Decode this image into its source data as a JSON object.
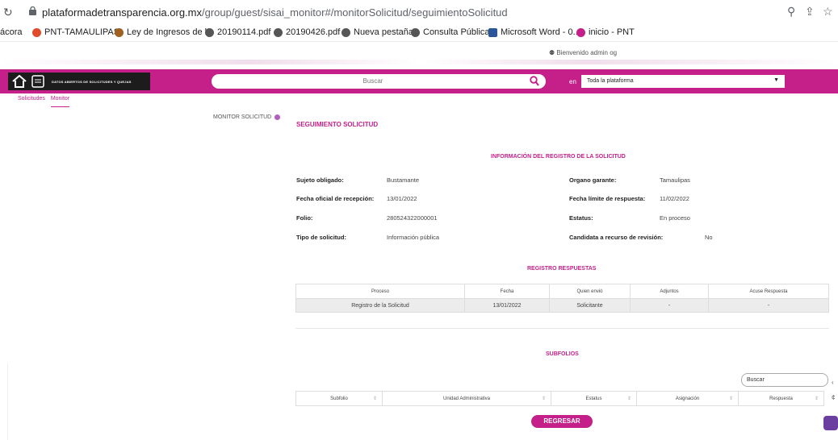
{
  "browser": {
    "url_host": "plataformadetransparencia.org.mx",
    "url_path": "/group/guest/sisai_monitor#/monitorSolicitud/seguimientoSolicitud",
    "bookmarks": [
      "ácora",
      "PNT-TAMAULIPAS",
      "Ley de Ingresos de l...",
      "20190114.pdf",
      "20190426.pdf",
      "Nueva pestaña",
      "Consulta Pública",
      "Microsoft Word - 0...",
      "inicio - PNT"
    ]
  },
  "header": {
    "welcome": "Bienvenido admin og",
    "logo_text": "DATOS ABIERTOS DE SOLICITUDES Y QUEJAS",
    "search_placeholder": "Buscar",
    "scope_prefix": "en",
    "scope_value": "Toda la plataforma"
  },
  "subnav": {
    "items": [
      "Solicitudes",
      "Monitor"
    ]
  },
  "side": {
    "label": "MONITOR SOLICITUD"
  },
  "main": {
    "title": "SEGUIMIENTO SOLICITUD",
    "info_heading": "INFORMACIÓN DEL REGISTRO DE LA SOLICITUD",
    "fields": {
      "sujeto_label": "Sujeto obligado:",
      "sujeto_value": "Bustamante",
      "organo_label": "Organo garante:",
      "organo_value": "Tamaulipas",
      "fecha_label": "Fecha oficial de recepción:",
      "fecha_value": "13/01/2022",
      "limite_label": "Fecha límite de respuesta:",
      "limite_value": "11/02/2022",
      "folio_label": "Folio:",
      "folio_value": "280524322000001",
      "estatus_label": "Estatus:",
      "estatus_value": "En proceso",
      "tipo_label": "Tipo de solicitud:",
      "tipo_value": "Información pública",
      "candidata_label": "Candidata a recurso de revisión:",
      "candidata_value": "No"
    },
    "registro_heading": "REGISTRO RESPUESTAS",
    "registro_columns": [
      "Proceso",
      "Fecha",
      "Quien envió",
      "Adjuntos",
      "Acuse Respuesta"
    ],
    "registro_row": [
      "Registro de la Solicitud",
      "13/01/2022",
      "Solicitante",
      "-",
      "-"
    ],
    "subfolios_heading": "SUBFOLIOS",
    "subfolios_search": "Buscar",
    "subfolios_columns": [
      "Subfolio",
      "Unidad Administrativa",
      "Estatus",
      "Asignación",
      "Respuesta"
    ],
    "back_label": "REGRESAR"
  }
}
